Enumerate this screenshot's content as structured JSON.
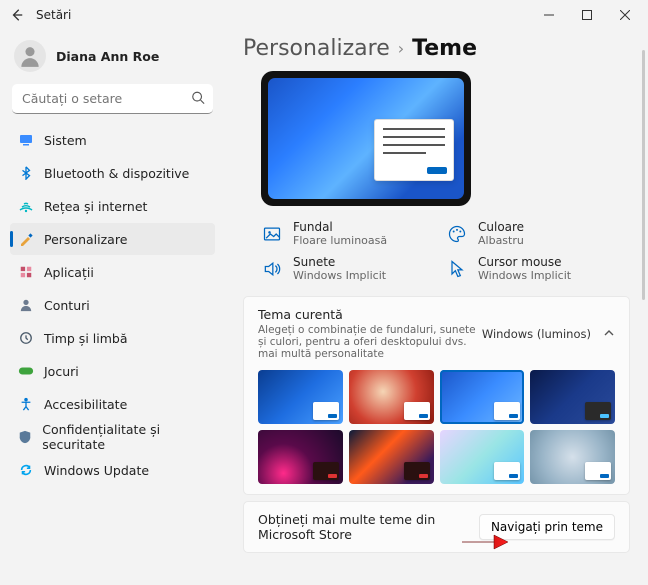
{
  "titlebar": {
    "title": "Setări"
  },
  "user": {
    "name": "Diana Ann Roe"
  },
  "search": {
    "placeholder": "Căutați o setare"
  },
  "sidebar": {
    "items": [
      {
        "id": "sistem",
        "label": "Sistem",
        "color": "#0078d4"
      },
      {
        "id": "bluetooth",
        "label": "Bluetooth & dispozitive",
        "color": "#0078d4"
      },
      {
        "id": "retea",
        "label": "Rețea și internet",
        "color": "#00b7c3"
      },
      {
        "id": "personalizare",
        "label": "Personalizare",
        "color": "#e8a33d",
        "active": true
      },
      {
        "id": "aplicatii",
        "label": "Aplicații",
        "color": "#c44f6a"
      },
      {
        "id": "conturi",
        "label": "Conturi",
        "color": "#6b7a8f"
      },
      {
        "id": "timp",
        "label": "Timp și limbă",
        "color": "#4a5a6a"
      },
      {
        "id": "jocuri",
        "label": "Jocuri",
        "color": "#3ea33d"
      },
      {
        "id": "accesibilitate",
        "label": "Accesibilitate",
        "color": "#0078d4"
      },
      {
        "id": "confidentialitate",
        "label": "Confidențialitate și securitate",
        "color": "#5a7a9a"
      },
      {
        "id": "update",
        "label": "Windows Update",
        "color": "#00a4ef"
      }
    ]
  },
  "breadcrumb": {
    "parent": "Personalizare",
    "current": "Teme"
  },
  "summary": {
    "background": {
      "label": "Fundal",
      "value": "Floare luminoasă"
    },
    "color": {
      "label": "Culoare",
      "value": "Albastru"
    },
    "sounds": {
      "label": "Sunete",
      "value": "Windows Implicit"
    },
    "cursor": {
      "label": "Cursor mouse",
      "value": "Windows Implicit"
    }
  },
  "current_theme": {
    "title": "Tema curentă",
    "subtitle": "Alegeți o combinație de fundaluri, sunete și culori, pentru a oferi desktopului dvs. mai multă personalitate",
    "value": "Windows (luminos)"
  },
  "themes": [
    {
      "id": "win-blue-glow",
      "class": "t1",
      "dark": false
    },
    {
      "id": "santa-red",
      "class": "t2",
      "dark": false
    },
    {
      "id": "win-light",
      "class": "t3",
      "dark": false,
      "selected": true
    },
    {
      "id": "win-dark",
      "class": "t4",
      "dark": true
    },
    {
      "id": "magenta-dark",
      "class": "t5",
      "dark": true,
      "red": true
    },
    {
      "id": "sunrise-dark",
      "class": "t6",
      "dark": true,
      "red": true
    },
    {
      "id": "pastel-flow",
      "class": "t7",
      "dark": false
    },
    {
      "id": "silver-swirl",
      "class": "t8",
      "dark": false
    }
  ],
  "store": {
    "text": "Obțineți mai multe teme din Microsoft Store",
    "button": "Navigați prin teme"
  }
}
